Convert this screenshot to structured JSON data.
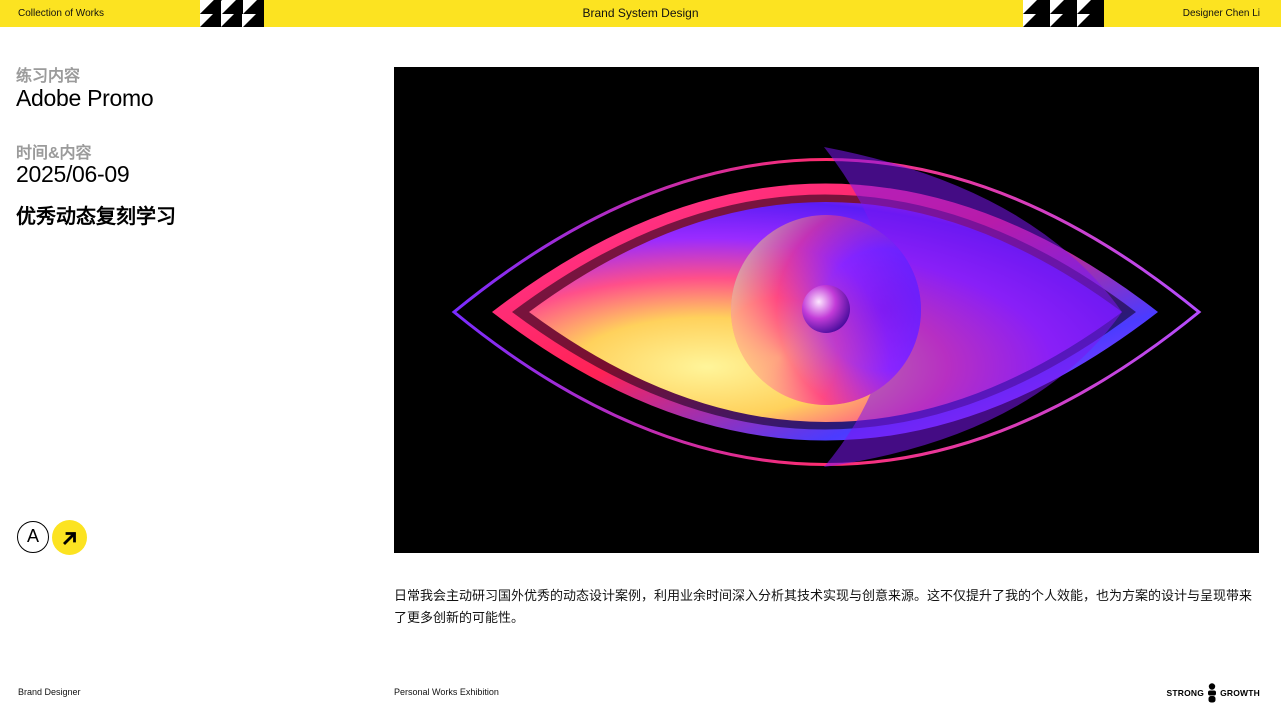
{
  "header": {
    "left_text": "Collection of Works",
    "center_text": "Brand System Design",
    "right_text": "Designer Chen Li"
  },
  "project": {
    "name_label": "练习内容",
    "name_value": "Adobe Promo",
    "date_label": "时间&内容",
    "date_value": "2025/06-09",
    "subject": "优秀动态复刻学习"
  },
  "badges": {
    "letter": "A",
    "arrow_icon": "arrow-up-right-icon"
  },
  "artwork": {
    "subject_icon": "eye-graphic",
    "background": "#000000",
    "colors": [
      "#7a1cf0",
      "#ff2d55",
      "#ff3ea5",
      "#fff27a",
      "#3d2bff"
    ]
  },
  "description": "日常我会主动研习国外优秀的动态设计案例，利用业余时间深入分析其技术实现与创意来源。这不仅提升了我的个人效能，也为方案的设计与呈现带来了更多创新的可能性。",
  "footer": {
    "left_text": "Brand Designer",
    "center_text": "Personal Works Exhibition",
    "brand_left": "STRONG",
    "brand_right": "GROWTH"
  },
  "theme": {
    "accent": "#fce321",
    "label_gray": "#9b9b9b"
  }
}
